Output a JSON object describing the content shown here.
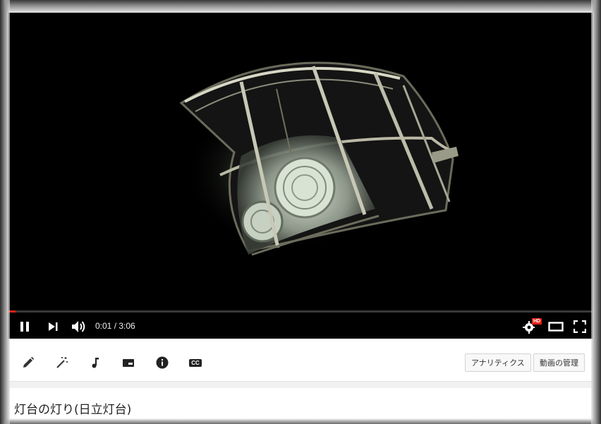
{
  "player": {
    "current_time": "0:01",
    "duration": "3:06",
    "time_display": "0:01 / 3:06",
    "progress_fraction": 0.005,
    "quality_badge": "HD",
    "colors": {
      "progress": "#e62117",
      "background": "#000000"
    }
  },
  "controls": {
    "left": [
      "pause-icon",
      "next-icon",
      "volume-icon"
    ],
    "right": [
      "settings-icon",
      "theater-mode-icon",
      "fullscreen-icon"
    ]
  },
  "toolbar": {
    "tools": [
      "pencil-icon",
      "magic-wand-icon",
      "music-note-icon",
      "annotations-icon",
      "info-icon",
      "captions-icon"
    ],
    "captions_label": "CC",
    "analytics_label": "アナリティクス",
    "manage_label": "動画の管理"
  },
  "video": {
    "title": "灯台の灯り(日立灯台)"
  }
}
